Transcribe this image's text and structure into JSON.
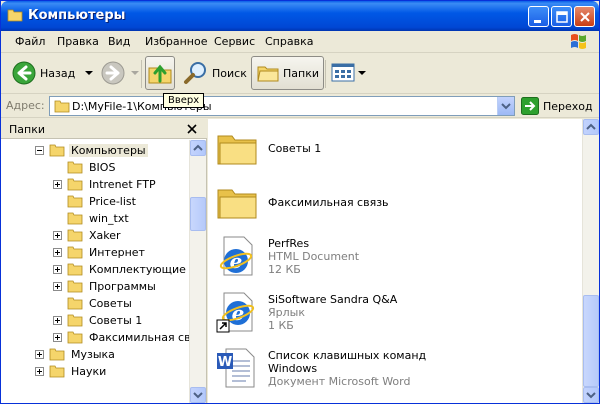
{
  "window": {
    "title": "Компьютеры"
  },
  "menu": [
    "Файл",
    "Правка",
    "Вид",
    "Избранное",
    "Сервис",
    "Справка"
  ],
  "toolbar": {
    "back_label": "Назад",
    "search_label": "Поиск",
    "folders_label": "Папки",
    "up_tooltip": "Вверх"
  },
  "address": {
    "label": "Адрес:",
    "value": "D:\\MyFile-1\\Компьютеры",
    "go_label": "Переход"
  },
  "folders_pane": {
    "title": "Папки",
    "items": [
      {
        "label": "Компьютеры",
        "expander": "minus",
        "level": 1,
        "selected": true
      },
      {
        "label": "BIOS",
        "expander": "none",
        "level": 2
      },
      {
        "label": "Intrenet FTP",
        "expander": "plus",
        "level": 2
      },
      {
        "label": "Price-list",
        "expander": "none",
        "level": 2
      },
      {
        "label": "win_txt",
        "expander": "none",
        "level": 2
      },
      {
        "label": "Xaker",
        "expander": "plus",
        "level": 2
      },
      {
        "label": "Интернет",
        "expander": "plus",
        "level": 2
      },
      {
        "label": "Комплектующие",
        "expander": "plus",
        "level": 2
      },
      {
        "label": "Программы",
        "expander": "plus",
        "level": 2
      },
      {
        "label": "Советы",
        "expander": "none",
        "level": 2
      },
      {
        "label": "Советы 1",
        "expander": "plus",
        "level": 2
      },
      {
        "label": "Факсимильная связь",
        "expander": "plus",
        "level": 2
      },
      {
        "label": "Музыка",
        "expander": "plus",
        "level": 0
      },
      {
        "label": "Науки",
        "expander": "plus",
        "level": 0
      }
    ]
  },
  "files": [
    {
      "name": "Советы 1",
      "type": "",
      "size": "",
      "icon": "folder-icon"
    },
    {
      "name": "Факсимильная связь",
      "type": "",
      "size": "",
      "icon": "folder-icon"
    },
    {
      "name": "PerfRes",
      "type": "HTML Document",
      "size": "12 КБ",
      "icon": "ie-document-icon"
    },
    {
      "name": "SiSoftware Sandra Q&A",
      "type": "Ярлык",
      "size": "1 КБ",
      "icon": "ie-shortcut-icon"
    },
    {
      "name": "Список клавишных команд",
      "name2": "Windows",
      "type": "Документ Microsoft Word",
      "icon": "word-document-icon"
    }
  ],
  "colors": {
    "titlebar": "#0058e6",
    "address_border": "#7f9db9",
    "go_green": "#2ea02e"
  }
}
